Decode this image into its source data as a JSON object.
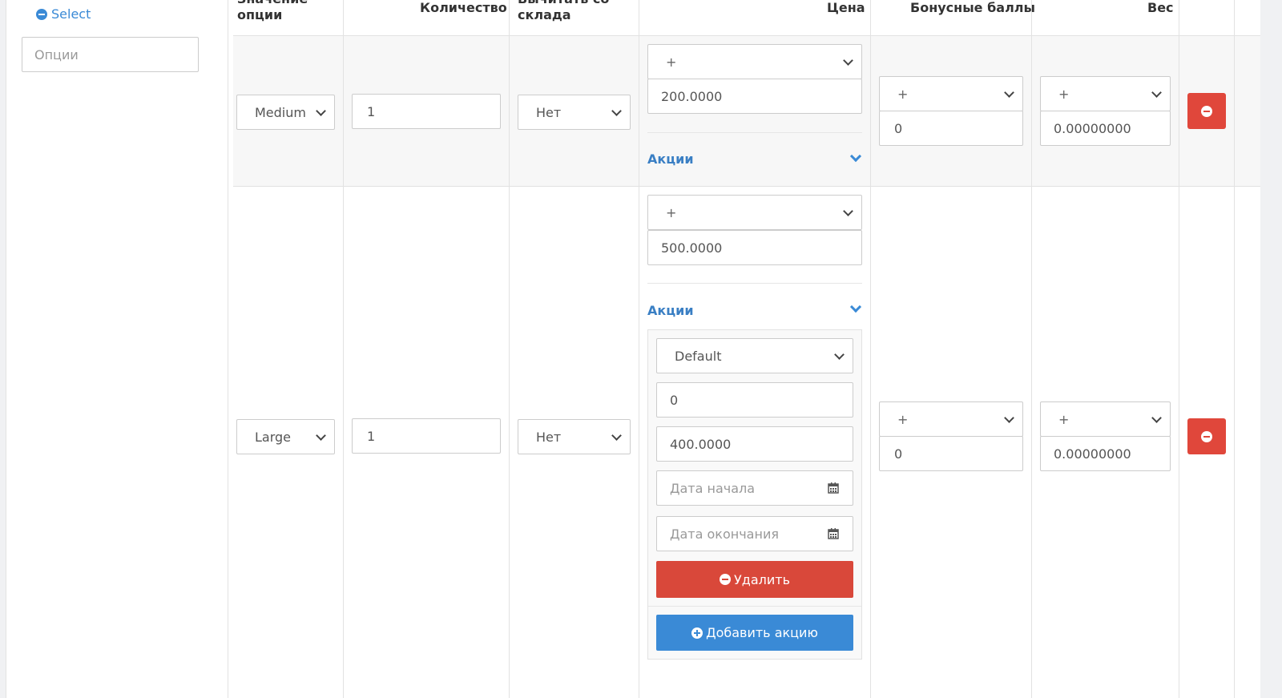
{
  "sidebar": {
    "select_label": "Select",
    "options_placeholder": "Опции"
  },
  "table": {
    "headers": {
      "option_value": [
        "Значение",
        "опции"
      ],
      "quantity": "Количество",
      "subtract": [
        "Вычитать со",
        "склада"
      ],
      "price": "Цена",
      "points": "Бонусные баллы",
      "weight": "Вес"
    },
    "rows": [
      {
        "option_value": "Medium",
        "quantity": "1",
        "subtract": "Нет",
        "price_prefix": "+",
        "price": "200.0000",
        "promo_label": "Акции",
        "points_prefix": "+",
        "points": "0",
        "weight_prefix": "+",
        "weight": "0.00000000"
      },
      {
        "option_value": "Large",
        "quantity": "1",
        "subtract": "Нет",
        "price_prefix": "+",
        "price": "500.0000",
        "promo_label": "Акции",
        "points_prefix": "+",
        "points": "0",
        "weight_prefix": "+",
        "weight": "0.00000000",
        "promo": {
          "customer_group": "Default",
          "priority": "0",
          "price": "400.0000",
          "date_start_placeholder": "Дата начала",
          "date_end_placeholder": "Дата окончания",
          "delete_label": "Удалить",
          "add_label": "Добавить акцию"
        }
      }
    ]
  },
  "colors": {
    "accent_blue": "#3a8ad6",
    "danger_red": "#e0473b"
  }
}
